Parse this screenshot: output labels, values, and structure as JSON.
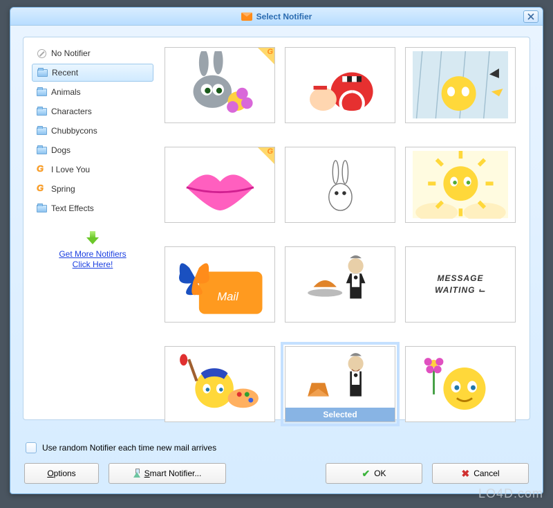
{
  "titlebar": {
    "title": "Select Notifier"
  },
  "sidebar": {
    "items": [
      {
        "label": "No Notifier",
        "icon": "none"
      },
      {
        "label": "Recent",
        "icon": "folder",
        "selected": true
      },
      {
        "label": "Animals",
        "icon": "folder"
      },
      {
        "label": "Characters",
        "icon": "folder"
      },
      {
        "label": "Chubbycons",
        "icon": "folder"
      },
      {
        "label": "Dogs",
        "icon": "folder"
      },
      {
        "label": "I Love You",
        "icon": "g"
      },
      {
        "label": "Spring",
        "icon": "g"
      },
      {
        "label": "Text Effects",
        "icon": "folder"
      }
    ],
    "get_more_line1": "Get More Notifiers",
    "get_more_line2": "Click Here!"
  },
  "grid": {
    "items": [
      {
        "name": "bunny-flower",
        "g_badge": true
      },
      {
        "name": "racing-snail",
        "g_badge": false
      },
      {
        "name": "rain-smiley",
        "g_badge": false
      },
      {
        "name": "pink-lips",
        "g_badge": true
      },
      {
        "name": "small-bunny",
        "g_badge": false
      },
      {
        "name": "sun-smiley",
        "g_badge": false
      },
      {
        "name": "butterfly-mail",
        "g_badge": false,
        "caption": "Mail"
      },
      {
        "name": "waiter-tray",
        "g_badge": false
      },
      {
        "name": "message-waiting-text",
        "g_badge": false,
        "caption": "MESSAGE WAITING"
      },
      {
        "name": "painter-smiley",
        "g_badge": false
      },
      {
        "name": "waiter-envelope",
        "g_badge": false,
        "selected": true,
        "selected_label": "Selected"
      },
      {
        "name": "flower-smiley",
        "g_badge": false
      }
    ]
  },
  "footer": {
    "random_label": "Use random Notifier each time new mail arrives",
    "options_label": "Options",
    "smart_label": "Smart Notifier...",
    "ok_label": "OK",
    "cancel_label": "Cancel"
  },
  "watermark": "LO4D.com"
}
